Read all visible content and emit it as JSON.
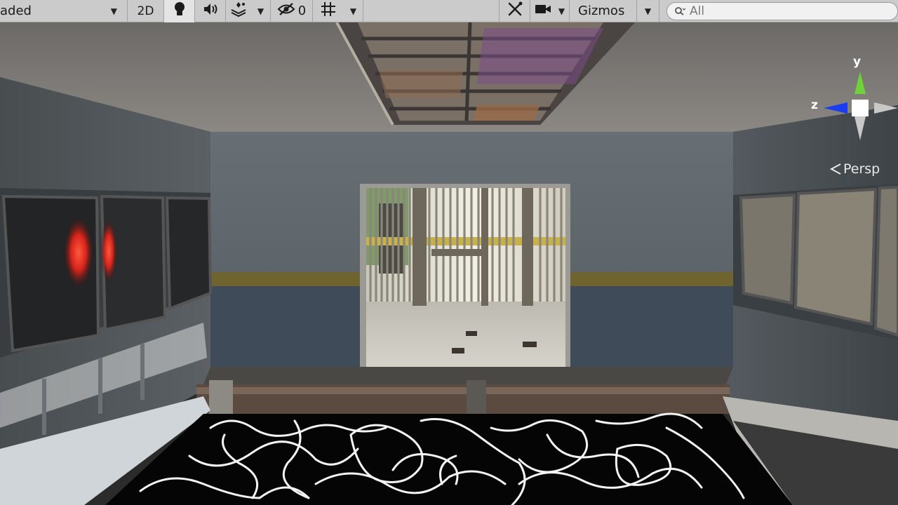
{
  "toolbar": {
    "shading_mode": "aded",
    "view_2d": "2D",
    "hidden_count": "0",
    "gizmos_label": "Gizmos",
    "search_placeholder": "All"
  },
  "gizmo": {
    "y_label": "y",
    "z_label": "z",
    "projection": "Persp"
  },
  "colors": {
    "toolbar_bg": "#cbcbcb",
    "axis_y": "#6fd23a",
    "axis_z": "#1c3cf0",
    "axis_neutral": "#c8c8c8"
  },
  "icons": [
    "light-bulb-icon",
    "audio-icon",
    "effects-icon",
    "hidden-objects-icon",
    "grid-icon",
    "tools-icon",
    "camera-icon",
    "search-icon",
    "chevron-down-icon"
  ]
}
